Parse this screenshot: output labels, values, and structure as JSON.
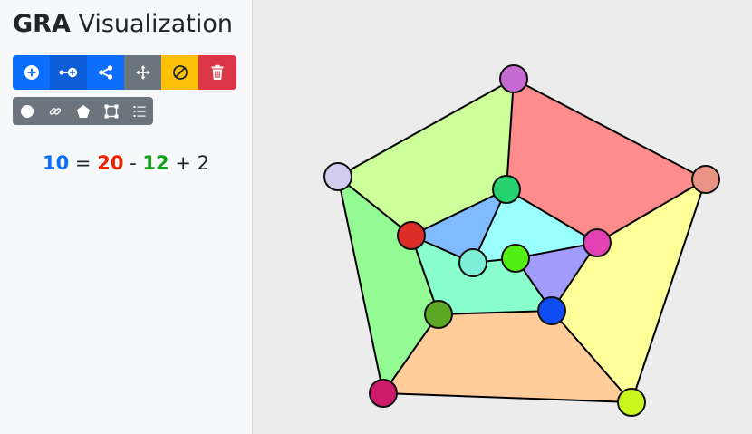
{
  "app": {
    "title_bold": "GRA",
    "title_rest": "Visualization"
  },
  "toolbar_main": [
    {
      "name": "add-vertex-button",
      "icon": "plus-circle-icon",
      "color": "#0d6efd"
    },
    {
      "name": "add-edge-button",
      "icon": "connect-icon",
      "color": "#0b5ed7"
    },
    {
      "name": "share-button",
      "icon": "share-icon",
      "color": "#0d6efd"
    },
    {
      "name": "move-button",
      "icon": "move-arrows-icon",
      "color": "#6c757d"
    },
    {
      "name": "clear-button",
      "icon": "ban-icon",
      "color": "#ffc107"
    },
    {
      "name": "delete-button",
      "icon": "trash-icon",
      "color": "#dc3545"
    }
  ],
  "toolbar_shapes": [
    {
      "name": "circle-tool-button",
      "icon": "circle-icon"
    },
    {
      "name": "link-tool-button",
      "icon": "link-icon"
    },
    {
      "name": "pentagon-tool-button",
      "icon": "pentagon-icon"
    },
    {
      "name": "square-tool-button",
      "icon": "square-nodes-icon"
    },
    {
      "name": "list-tool-button",
      "icon": "list-icon"
    }
  ],
  "formula": {
    "faces": "10",
    "eq": "=",
    "edges": "20",
    "minus": "-",
    "vertices": "12",
    "plus": "+",
    "constant": "2",
    "colors": {
      "faces": "#0d6efd",
      "edges": "#ee2200",
      "vertices": "#12a11f"
    }
  },
  "graph": {
    "faces": [
      {
        "color": "#ccff99"
      },
      {
        "color": "#ff8c8c"
      },
      {
        "color": "#ffff99"
      },
      {
        "color": "#ffcc9a"
      },
      {
        "color": "#94fa94"
      },
      {
        "color": "#80bbff"
      },
      {
        "color": "#99ffff"
      },
      {
        "color": "#a29cff"
      },
      {
        "color": "#88ffcc"
      },
      {
        "color": "#88ffcc"
      }
    ],
    "vertices": [
      {
        "color": "#c76ad4"
      },
      {
        "color": "#e99384"
      },
      {
        "color": "#c9f71d"
      },
      {
        "color": "#ce1a6a"
      },
      {
        "color": "#d2cdf0"
      },
      {
        "color": "#28d26f"
      },
      {
        "color": "#e240b3"
      },
      {
        "color": "#0e4cf4"
      },
      {
        "color": "#5ba623"
      },
      {
        "color": "#dc2d27"
      },
      {
        "color": "#7ff0d8"
      },
      {
        "color": "#53ef11"
      }
    ]
  }
}
